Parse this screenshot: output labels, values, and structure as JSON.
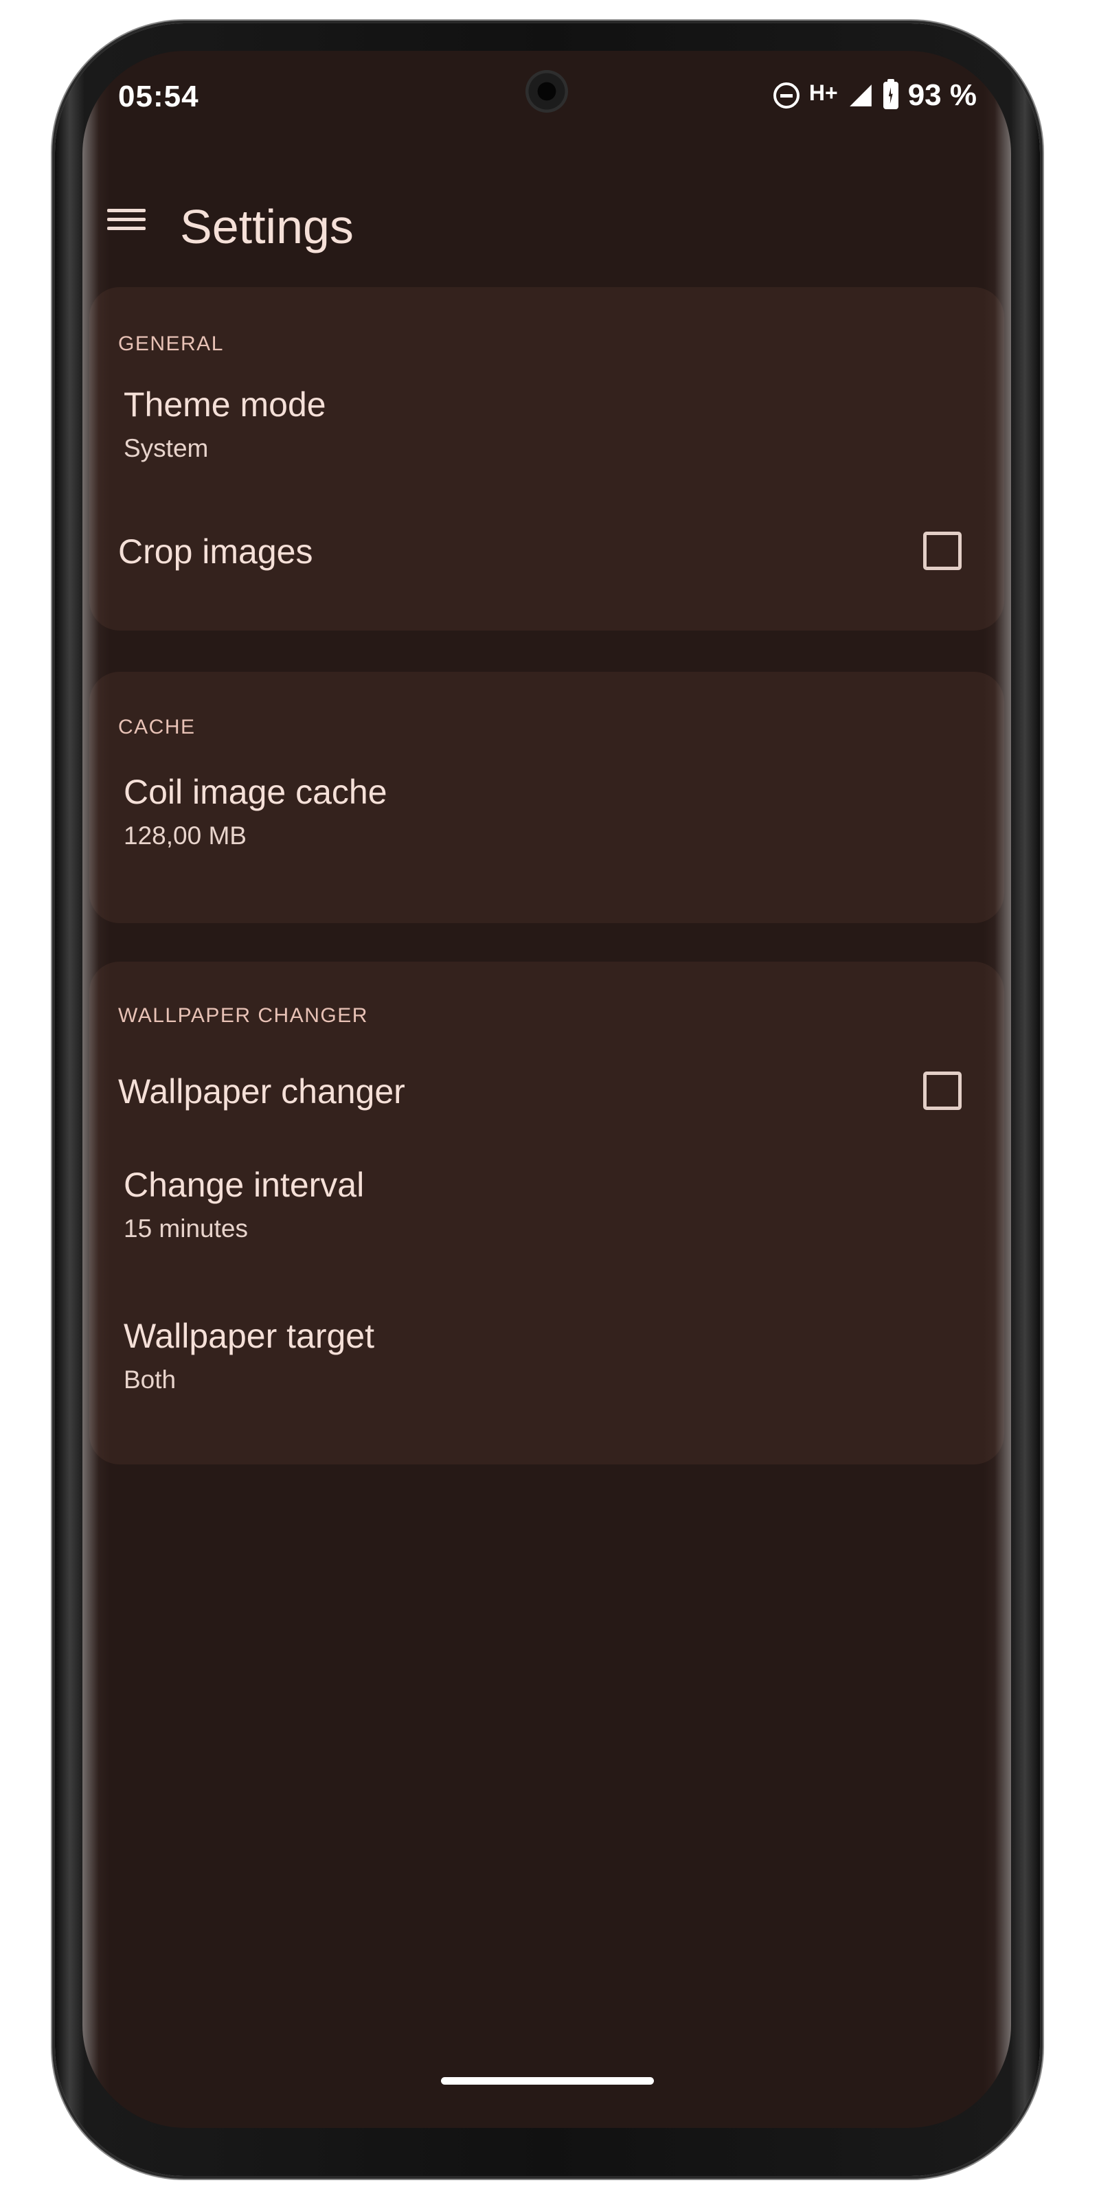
{
  "status_bar": {
    "time": "05:54",
    "network_type": "H+",
    "battery": "93 %",
    "icons": [
      "do-not-disturb-icon",
      "signal-icon",
      "battery-charging-icon"
    ]
  },
  "app_bar": {
    "title": "Settings",
    "menu_icon": "menu-icon"
  },
  "sections": {
    "general": {
      "header": "GENERAL",
      "theme_mode": {
        "title": "Theme mode",
        "summary": "System"
      },
      "crop_images": {
        "title": "Crop images",
        "checked": false
      }
    },
    "cache": {
      "header": "CACHE",
      "coil_cache": {
        "title": "Coil image cache",
        "summary": "128,00 MB"
      }
    },
    "wallpaper": {
      "header": "WALLPAPER CHANGER",
      "changer": {
        "title": "Wallpaper changer",
        "checked": false
      },
      "interval": {
        "title": "Change interval",
        "summary": "15 minutes"
      },
      "target": {
        "title": "Wallpaper target",
        "summary": "Both"
      }
    }
  },
  "colors": {
    "background": "#261916",
    "card": "#34221d",
    "text_primary": "#f5e0d8",
    "section_header": "#e8c2b6"
  }
}
